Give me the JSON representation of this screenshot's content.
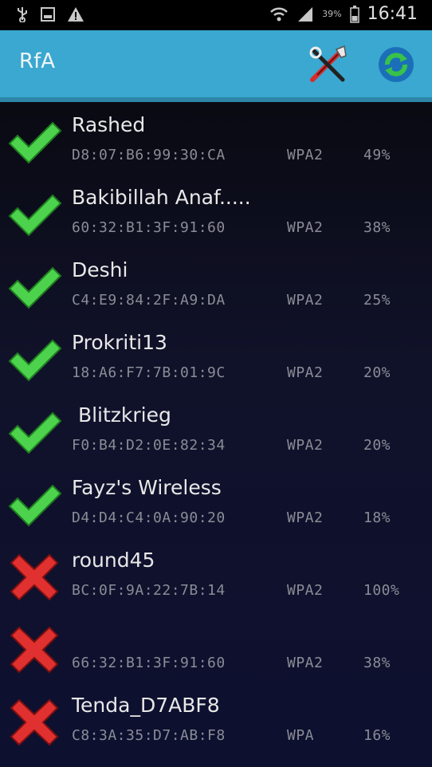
{
  "status_bar": {
    "time": "16:41",
    "battery_text": "39%"
  },
  "action_bar": {
    "title": "RfA",
    "accent_color": "#3aa8d0"
  },
  "networks": [
    {
      "ssid": "Rashed",
      "bssid": "D8:07:B6:99:30:CA",
      "security": "WPA2",
      "signal": "49%",
      "status": "check"
    },
    {
      "ssid": "Bakibillah Anaf.....",
      "bssid": "60:32:B1:3F:91:60",
      "security": "WPA2",
      "signal": "38%",
      "status": "check"
    },
    {
      "ssid": "Deshi",
      "bssid": "C4:E9:84:2F:A9:DA",
      "security": "WPA2",
      "signal": "25%",
      "status": "check"
    },
    {
      "ssid": "Prokriti13",
      "bssid": "18:A6:F7:7B:01:9C",
      "security": "WPA2",
      "signal": "20%",
      "status": "check"
    },
    {
      "ssid": " Blitzkrieg",
      "bssid": "F0:B4:D2:0E:82:34",
      "security": "WPA2",
      "signal": "20%",
      "status": "check"
    },
    {
      "ssid": "Fayz's Wireless",
      "bssid": "D4:D4:C4:0A:90:20",
      "security": "WPA2",
      "signal": "18%",
      "status": "check"
    },
    {
      "ssid": "round45",
      "bssid": "BC:0F:9A:22:7B:14",
      "security": "WPA2",
      "signal": "100%",
      "status": "cross"
    },
    {
      "ssid": "",
      "bssid": "66:32:B1:3F:91:60",
      "security": "WPA2",
      "signal": "38%",
      "status": "cross"
    },
    {
      "ssid": "Tenda_D7ABF8",
      "bssid": "C8:3A:35:D7:AB:F8",
      "security": "WPA",
      "signal": "16%",
      "status": "cross"
    }
  ]
}
